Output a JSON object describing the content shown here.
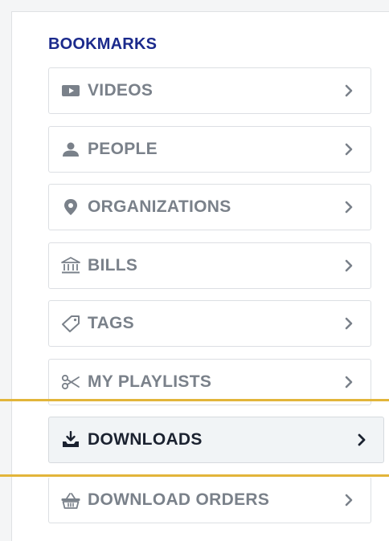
{
  "section": {
    "title": "BOOKMARKS"
  },
  "items": [
    {
      "label": "VIDEOS",
      "icon": "video-icon",
      "active": false
    },
    {
      "label": "PEOPLE",
      "icon": "person-icon",
      "active": false
    },
    {
      "label": "ORGANIZATIONS",
      "icon": "location-pin-icon",
      "active": false
    },
    {
      "label": "BILLS",
      "icon": "capitol-building-icon",
      "active": false
    },
    {
      "label": "TAGS",
      "icon": "tag-icon",
      "active": false
    },
    {
      "label": "MY PLAYLISTS",
      "icon": "scissors-icon",
      "active": false
    },
    {
      "label": "DOWNLOADS",
      "icon": "download-tray-icon",
      "active": true
    },
    {
      "label": "DOWNLOAD ORDERS",
      "icon": "basket-icon",
      "active": false
    }
  ],
  "colors": {
    "title": "#1b2a8c",
    "label_inactive": "#7a818a",
    "label_active": "#1b2230",
    "highlight": "#e2b53a"
  }
}
